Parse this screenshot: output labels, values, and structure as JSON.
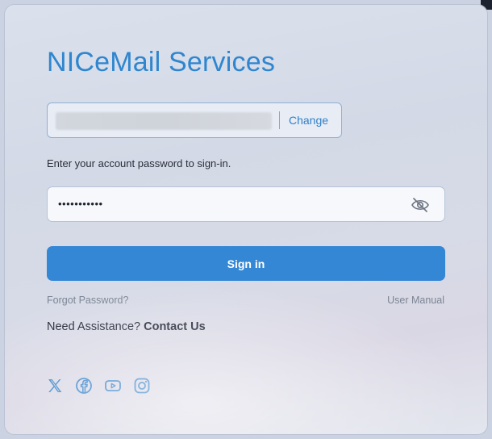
{
  "app": {
    "title": "NICeMail Services"
  },
  "account": {
    "change_label": "Change"
  },
  "password": {
    "prompt": "Enter your account password to sign-in.",
    "masked_value": "•••••••••••",
    "toggle_icon": "eye-slash-icon"
  },
  "actions": {
    "signin_label": "Sign in",
    "forgot_label": "Forgot Password?",
    "manual_label": "User Manual"
  },
  "assistance": {
    "prefix": "Need Assistance?",
    "link": "Contact Us"
  },
  "social": {
    "icons": [
      "x-icon",
      "facebook-icon",
      "youtube-icon",
      "instagram-icon"
    ]
  },
  "colors": {
    "accent": "#3487d4",
    "title": "#2f86cf",
    "icon": "#2f7fc7"
  }
}
